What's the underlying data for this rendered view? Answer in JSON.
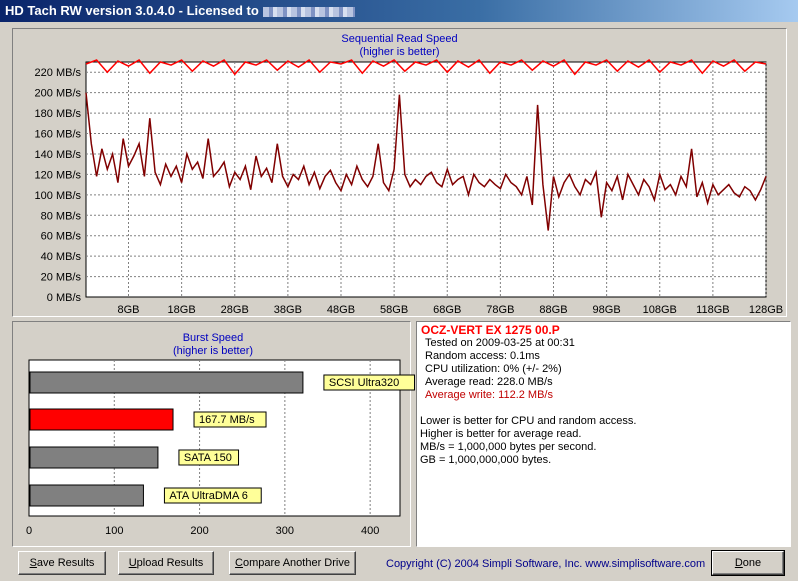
{
  "window": {
    "title": "HD Tach RW version 3.0.4.0  -  Licensed to"
  },
  "read_chart": {
    "title": "Sequential Read Speed",
    "subtitle": "(higher is better)"
  },
  "burst_chart": {
    "title": "Burst Speed",
    "subtitle": "(higher is better)"
  },
  "chart_data": [
    {
      "type": "line",
      "title": "Sequential Read Speed",
      "subtitle": "(higher is better)",
      "xlabel": "",
      "ylabel": "",
      "x_ticks": [
        "8GB",
        "18GB",
        "28GB",
        "38GB",
        "48GB",
        "58GB",
        "68GB",
        "78GB",
        "88GB",
        "98GB",
        "108GB",
        "118GB",
        "128GB"
      ],
      "y_ticks": [
        "0 MB/s",
        "20 MB/s",
        "40 MB/s",
        "60 MB/s",
        "80 MB/s",
        "100 MB/s",
        "120 MB/s",
        "140 MB/s",
        "160 MB/s",
        "180 MB/s",
        "200 MB/s",
        "220 MB/s"
      ],
      "xlim": [
        0,
        128
      ],
      "ylim": [
        0,
        230
      ],
      "grid": true,
      "series": [
        {
          "color": "#ff0000",
          "x": [
            0,
            2,
            4,
            6,
            8,
            10,
            12,
            14,
            16,
            18,
            20,
            22,
            24,
            26,
            28,
            30,
            32,
            34,
            36,
            38,
            40,
            42,
            44,
            46,
            48,
            50,
            52,
            54,
            56,
            58,
            60,
            62,
            64,
            66,
            68,
            70,
            72,
            74,
            76,
            78,
            80,
            82,
            84,
            86,
            88,
            90,
            92,
            94,
            96,
            98,
            100,
            102,
            104,
            106,
            108,
            110,
            112,
            114,
            116,
            118,
            120,
            122,
            124,
            126,
            128
          ],
          "y": [
            228,
            232,
            220,
            231,
            226,
            232,
            219,
            230,
            227,
            232,
            221,
            231,
            226,
            232,
            218,
            230,
            227,
            232,
            222,
            231,
            225,
            232,
            220,
            230,
            228,
            232,
            219,
            231,
            226,
            232,
            221,
            230,
            227,
            232,
            220,
            231,
            225,
            232,
            219,
            230,
            227,
            232,
            222,
            231,
            226,
            232,
            218,
            230,
            227,
            232,
            221,
            231,
            225,
            232,
            220,
            230,
            227,
            232,
            219,
            231,
            226,
            232,
            221,
            230,
            228
          ]
        },
        {
          "color": "#800000",
          "x": [
            0,
            1,
            2,
            3,
            4,
            5,
            6,
            7,
            8,
            9,
            10,
            11,
            12,
            13,
            14,
            15,
            16,
            17,
            18,
            19,
            20,
            21,
            22,
            23,
            24,
            25,
            26,
            27,
            28,
            29,
            30,
            31,
            32,
            33,
            34,
            35,
            36,
            37,
            38,
            39,
            40,
            41,
            42,
            43,
            44,
            45,
            46,
            47,
            48,
            49,
            50,
            51,
            52,
            53,
            54,
            55,
            56,
            57,
            58,
            59,
            60,
            61,
            62,
            63,
            64,
            65,
            66,
            67,
            68,
            69,
            70,
            71,
            72,
            73,
            74,
            75,
            76,
            77,
            78,
            79,
            80,
            81,
            82,
            83,
            84,
            85,
            86,
            87,
            88,
            89,
            90,
            91,
            92,
            93,
            94,
            95,
            96,
            97,
            98,
            99,
            100,
            101,
            102,
            103,
            104,
            105,
            106,
            107,
            108,
            109,
            110,
            111,
            112,
            113,
            114,
            115,
            116,
            117,
            118,
            119,
            120,
            121,
            122,
            123,
            124,
            125,
            126,
            127,
            128
          ],
          "y": [
            200,
            150,
            118,
            145,
            125,
            140,
            112,
            155,
            128,
            138,
            150,
            118,
            175,
            122,
            110,
            130,
            118,
            128,
            112,
            140,
            125,
            132,
            116,
            155,
            118,
            124,
            132,
            108,
            122,
            115,
            128,
            105,
            138,
            118,
            126,
            112,
            150,
            118,
            108,
            120,
            115,
            128,
            110,
            122,
            106,
            118,
            124,
            112,
            104,
            120,
            110,
            128,
            115,
            108,
            118,
            150,
            112,
            104,
            125,
            198,
            120,
            108,
            115,
            110,
            118,
            122,
            112,
            108,
            125,
            110,
            115,
            118,
            100,
            120,
            112,
            108,
            115,
            110,
            106,
            120,
            112,
            108,
            100,
            118,
            90,
            188,
            110,
            65,
            118,
            98,
            112,
            120,
            108,
            100,
            115,
            110,
            122,
            78,
            112,
            104,
            118,
            95,
            120,
            110,
            100,
            115,
            108,
            95,
            120,
            105,
            110,
            100,
            118,
            108,
            145,
            98,
            112,
            92,
            110,
            100,
            105,
            110,
            102,
            98,
            108,
            104,
            95,
            105,
            118
          ]
        }
      ]
    },
    {
      "type": "bar",
      "title": "Burst Speed",
      "subtitle": "(higher is better)",
      "orientation": "horizontal",
      "x_ticks": [
        "0",
        "100",
        "200",
        "300",
        "400"
      ],
      "xlim": [
        0,
        435
      ],
      "grid": true,
      "categories": [
        "SCSI Ultra320",
        "167.7 MB/s",
        "SATA 150",
        "ATA UltraDMA 6"
      ],
      "values": [
        320,
        167.7,
        150,
        133
      ],
      "colors": [
        "#808080",
        "#ff0000",
        "#808080",
        "#808080"
      ]
    }
  ],
  "info": {
    "drive_name": "OCZ-VERT EX 1275 00.P",
    "tested": "Tested on 2009-03-25 at 00:31",
    "random_access": "Random access: 0.1ms",
    "cpu": "CPU utilization: 0% (+/- 2%)",
    "avg_read": "Average read: 228.0 MB/s",
    "avg_write": "Average write: 112.2 MB/s",
    "note1": "Lower is better for CPU and random access.",
    "note2": "Higher is better for average read.",
    "note3": "MB/s = 1,000,000 bytes per second.",
    "note4": "GB = 1,000,000,000 bytes.",
    "write_color": "#c00000"
  },
  "buttons": {
    "save_pre": "",
    "save_u": "S",
    "save_post": "ave Results",
    "upload_pre": "",
    "upload_u": "U",
    "upload_post": "pload Results",
    "compare_pre": "",
    "compare_u": "C",
    "compare_post": "ompare Another Drive",
    "done_pre": "",
    "done_u": "D",
    "done_post": "one"
  },
  "footer": {
    "copyright": "Copyright (C) 2004 Simpli Software, Inc. www.simplisoftware.com"
  }
}
